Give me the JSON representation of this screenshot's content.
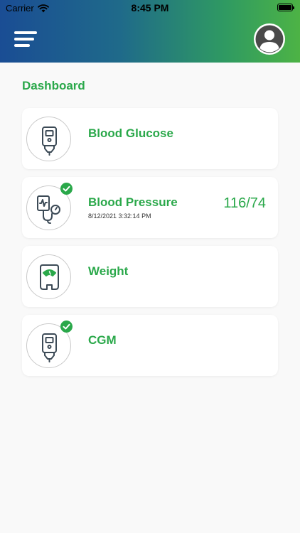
{
  "status_bar": {
    "carrier": "Carrier",
    "time": "8:45 PM"
  },
  "header": {
    "menu_icon": "hamburger-menu-icon",
    "avatar_icon": "user-avatar-icon"
  },
  "page": {
    "title": "Dashboard"
  },
  "cards": [
    {
      "title": "Blood Glucose",
      "icon": "glucose-meter-icon",
      "checked": false,
      "date": "",
      "value": ""
    },
    {
      "title": "Blood Pressure",
      "icon": "blood-pressure-monitor-icon",
      "checked": true,
      "date": "8/12/2021 3:32:14 PM",
      "value": "116/74"
    },
    {
      "title": "Weight",
      "icon": "weight-scale-icon",
      "checked": false,
      "date": "",
      "value": ""
    },
    {
      "title": "CGM",
      "icon": "cgm-device-icon",
      "checked": true,
      "date": "",
      "value": ""
    }
  ],
  "colors": {
    "accent": "#2aa84a",
    "header_start": "#1a4d94",
    "header_end": "#4db345",
    "icon_stroke": "#3c4a56"
  }
}
